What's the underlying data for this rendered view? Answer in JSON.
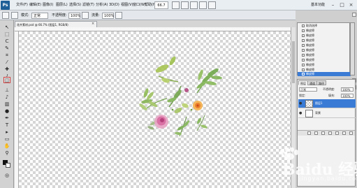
{
  "app": {
    "logo": "Ps",
    "workspace": "基本功能"
  },
  "menu": {
    "items": [
      "文件(F)",
      "编辑(E)",
      "图像(I)",
      "图层(L)",
      "选择(S)",
      "滤镜(T)",
      "分析(A)",
      "3D(D)",
      "视图(V)",
      "窗口(W)",
      "帮助(H)"
    ],
    "zoom": "66.7"
  },
  "options": {
    "mode_label": "模式:",
    "mode_value": "正常",
    "opacity_label": "不透明度:",
    "opacity_value": "100%",
    "flow_label": "流量:",
    "flow_value": "100%"
  },
  "document": {
    "tab_title": "花卉素材.psd @ 66.7% (图层1, RGB/8)",
    "close_glyph": "×"
  },
  "history": {
    "items": [
      "取消选择",
      "橡皮擦",
      "橡皮擦",
      "橡皮擦",
      "橡皮擦",
      "橡皮擦",
      "橡皮擦",
      "橡皮擦",
      "橡皮擦",
      "橡皮擦",
      "橡皮擦"
    ],
    "selected_index": 10
  },
  "layers": {
    "tabs": [
      "图层",
      "通道",
      "路径"
    ],
    "blend": "正常",
    "opacity_label": "不透明度:",
    "opacity_value": "100%",
    "lock_label": "锁定:",
    "fill_label": "填充:",
    "fill_value": "100%",
    "rows": [
      {
        "name": "图层1",
        "selected": true
      },
      {
        "name": "背景",
        "selected": false
      }
    ]
  },
  "watermark": {
    "text": "Baidu 经验",
    "sub": "jingyan.baidu.com"
  },
  "colors": {
    "selection": "#3a7bd5",
    "accent_red": "#d04040"
  }
}
